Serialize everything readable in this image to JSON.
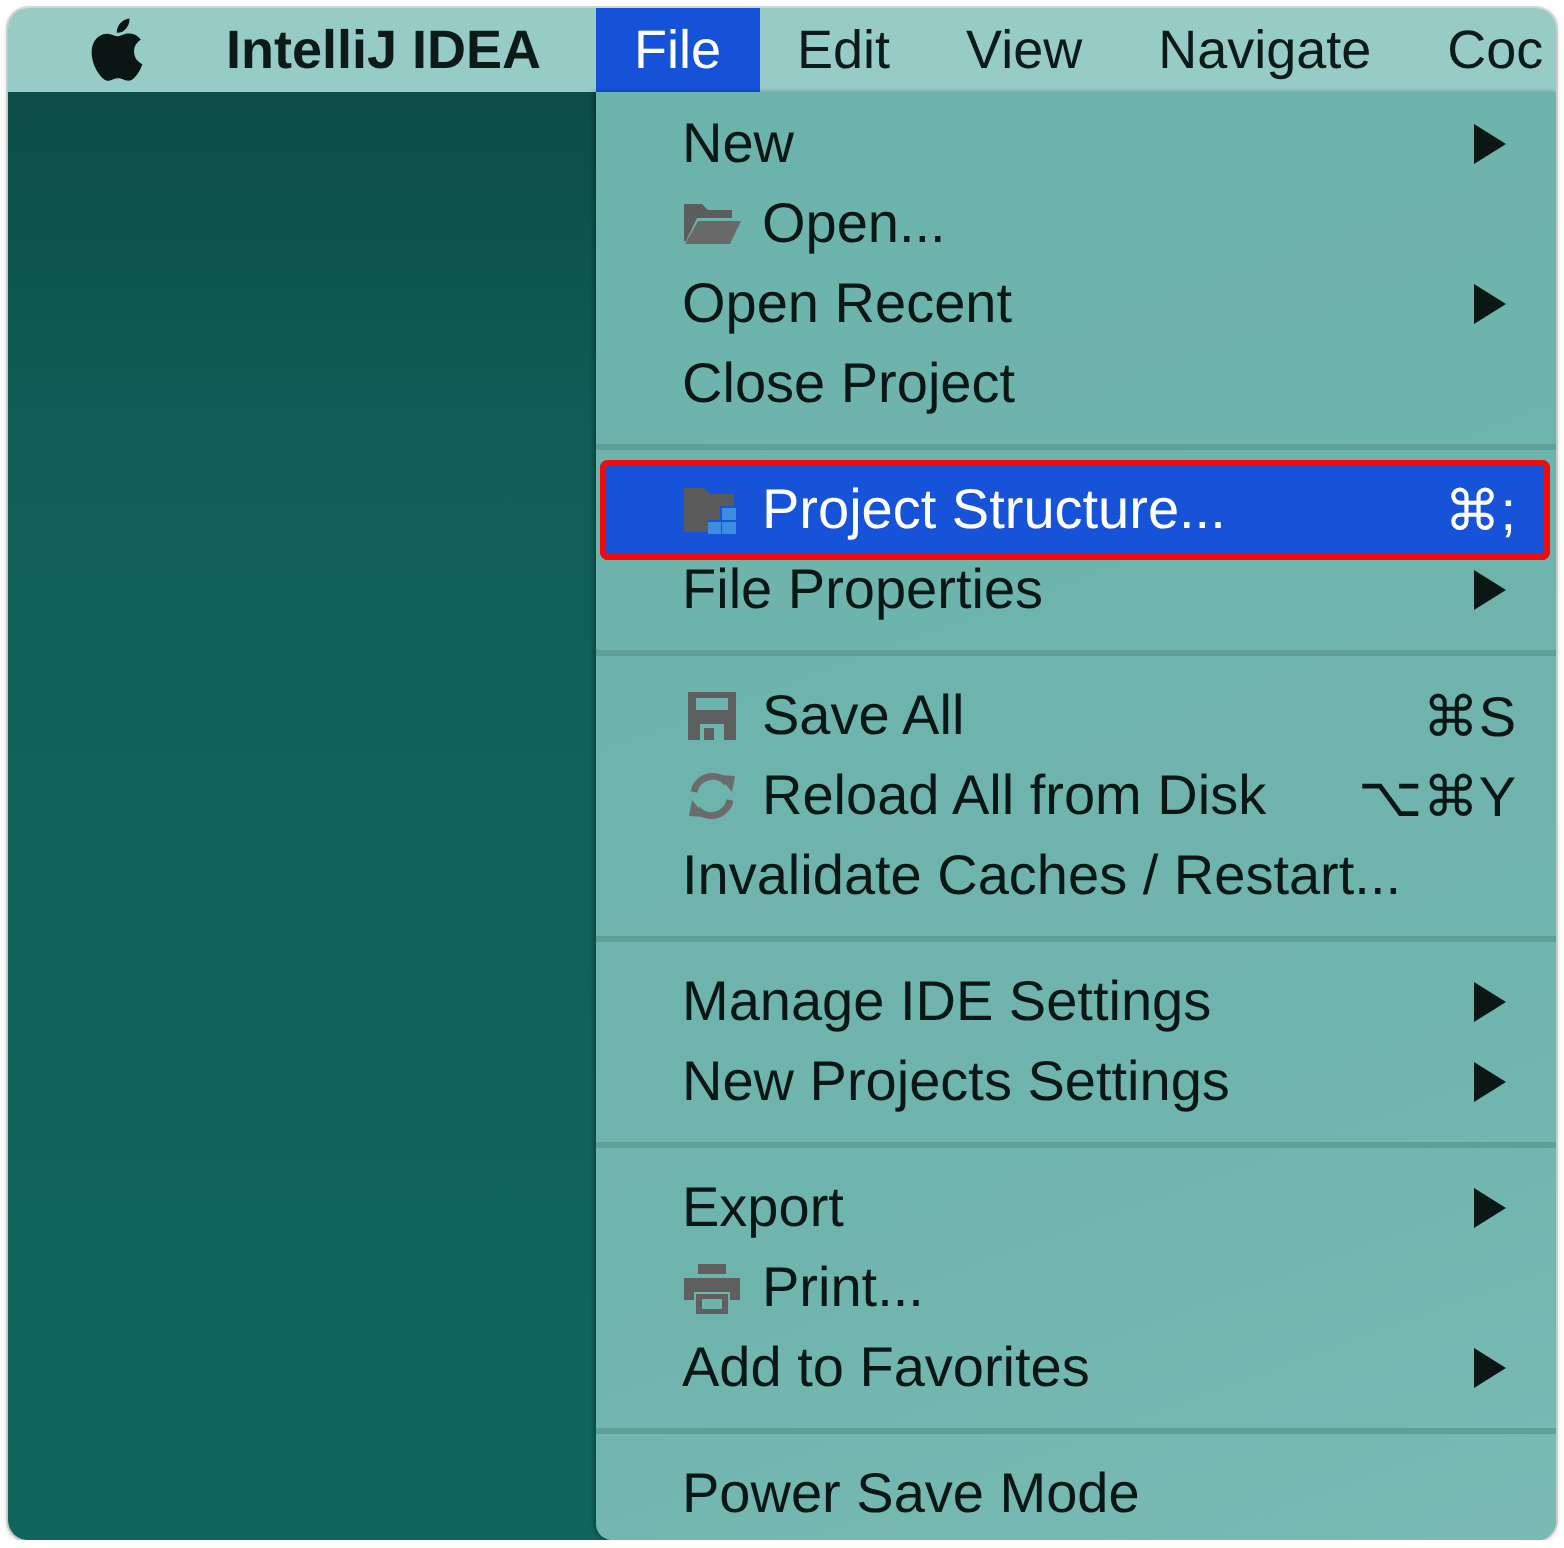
{
  "menu_bar": {
    "app_name": "IntelliJ IDEA",
    "menus": [
      {
        "label": "File",
        "selected": true
      },
      {
        "label": "Edit",
        "selected": false
      },
      {
        "label": "View",
        "selected": false
      },
      {
        "label": "Navigate",
        "selected": false
      },
      {
        "label": "Coc",
        "selected": false
      }
    ]
  },
  "file_menu": {
    "groups": [
      {
        "items": [
          {
            "kind": "plain",
            "label": "New",
            "submenu": true,
            "selected": false,
            "outlined": false
          },
          {
            "kind": "open",
            "label": "Open...",
            "submenu": false,
            "selected": false,
            "outlined": false
          },
          {
            "kind": "plain",
            "label": "Open Recent",
            "submenu": true,
            "selected": false,
            "outlined": false
          },
          {
            "kind": "plain",
            "label": "Close Project",
            "submenu": false,
            "selected": false,
            "outlined": false
          }
        ]
      },
      {
        "items": [
          {
            "kind": "structure",
            "label": "Project Structure...",
            "shortcut": "⌘;",
            "submenu": false,
            "selected": true,
            "outlined": true
          },
          {
            "kind": "plain",
            "label": "File Properties",
            "submenu": true,
            "selected": false,
            "outlined": false
          }
        ]
      },
      {
        "items": [
          {
            "kind": "save",
            "label": "Save All",
            "shortcut": "⌘S",
            "submenu": false,
            "selected": false,
            "outlined": false
          },
          {
            "kind": "reload",
            "label": "Reload All from Disk",
            "shortcut": "⌥⌘Y",
            "submenu": false,
            "selected": false,
            "outlined": false
          },
          {
            "kind": "plain",
            "label": "Invalidate Caches / Restart...",
            "submenu": false,
            "selected": false,
            "outlined": false
          }
        ]
      },
      {
        "items": [
          {
            "kind": "plain",
            "label": "Manage IDE Settings",
            "submenu": true,
            "selected": false,
            "outlined": false
          },
          {
            "kind": "plain",
            "label": "New Projects Settings",
            "submenu": true,
            "selected": false,
            "outlined": false
          }
        ]
      },
      {
        "items": [
          {
            "kind": "plain",
            "label": "Export",
            "submenu": true,
            "selected": false,
            "outlined": false
          },
          {
            "kind": "print",
            "label": "Print...",
            "submenu": false,
            "selected": false,
            "outlined": false
          },
          {
            "kind": "plain",
            "label": "Add to Favorites",
            "submenu": true,
            "selected": false,
            "outlined": false
          }
        ]
      },
      {
        "items": [
          {
            "kind": "plain",
            "label": "Power Save Mode",
            "submenu": false,
            "selected": false,
            "outlined": false
          }
        ]
      }
    ]
  }
}
